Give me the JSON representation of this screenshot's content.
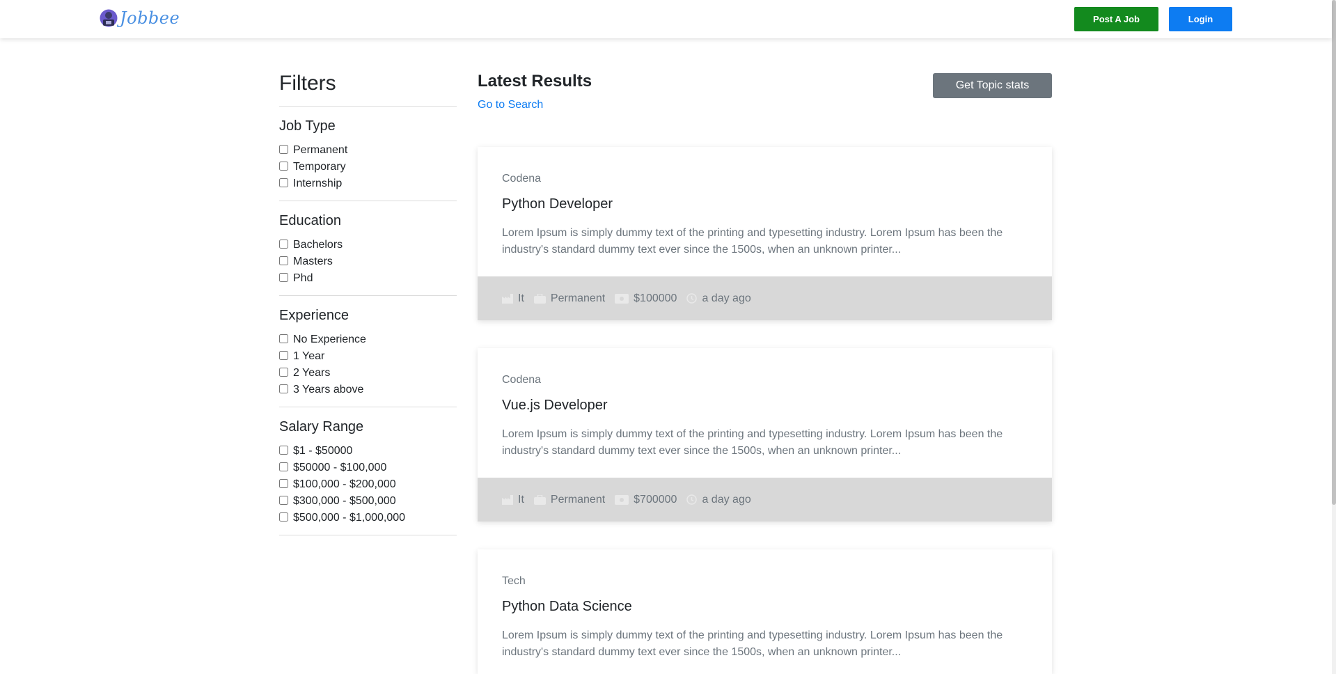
{
  "navbar": {
    "brand": "Jobbee",
    "post_job_label": "Post A Job",
    "login_label": "Login"
  },
  "filters": {
    "title": "Filters",
    "groups": [
      {
        "title": "Job Type",
        "options": [
          "Permanent",
          "Temporary",
          "Internship"
        ]
      },
      {
        "title": "Education",
        "options": [
          "Bachelors",
          "Masters",
          "Phd"
        ]
      },
      {
        "title": "Experience",
        "options": [
          "No Experience",
          "1 Year",
          "2 Years",
          "3 Years above"
        ]
      },
      {
        "title": "Salary Range",
        "options": [
          "$1 - $50000",
          "$50000 - $100,000",
          "$100,000 - $200,000",
          "$300,000 - $500,000",
          "$500,000 - $1,000,000"
        ]
      }
    ]
  },
  "main": {
    "title": "Latest Results",
    "go_to_search": "Go to Search",
    "topic_stats_label": "Get Topic stats",
    "jobs": [
      {
        "company": "Codena",
        "title": "Python Developer",
        "description": "Lorem Ipsum is simply dummy text of the printing and typesetting industry. Lorem Ipsum has been the industry's standard dummy text ever since the 1500s, when an unknown printer...",
        "industry": "It",
        "job_type": "Permanent",
        "salary": "$100000",
        "posted": "a day ago"
      },
      {
        "company": "Codena",
        "title": "Vue.js Developer",
        "description": "Lorem Ipsum is simply dummy text of the printing and typesetting industry. Lorem Ipsum has been the industry's standard dummy text ever since the 1500s, when an unknown printer...",
        "industry": "It",
        "job_type": "Permanent",
        "salary": "$700000",
        "posted": "a day ago"
      },
      {
        "company": "Tech",
        "title": "Python Data Science",
        "description": "Lorem Ipsum is simply dummy text of the printing and typesetting industry. Lorem Ipsum has been the industry's standard dummy text ever since the 1500s, when an unknown printer..."
      }
    ]
  },
  "colors": {
    "post_button": "#138a1e",
    "login_button": "#0d7cf2",
    "stats_button": "#6c757d",
    "card_footer": "#d8d8d8",
    "link": "#0d7cf2"
  },
  "icons": [
    "industry-icon",
    "briefcase-icon",
    "money-icon",
    "clock-icon"
  ]
}
